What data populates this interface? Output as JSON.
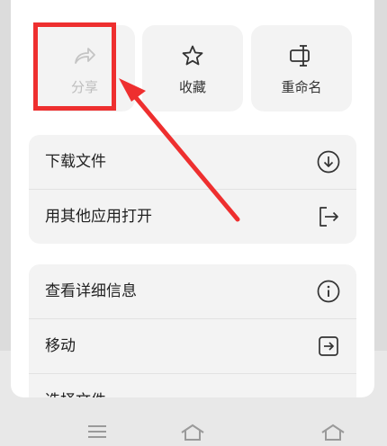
{
  "tiles": [
    {
      "label": "分享",
      "icon": "share-icon",
      "disabled": true
    },
    {
      "label": "收藏",
      "icon": "star-icon"
    },
    {
      "label": "重命名",
      "icon": "rename-icon"
    }
  ],
  "group1": [
    {
      "label": "下载文件",
      "icon": "download-icon"
    },
    {
      "label": "用其他应用打开",
      "icon": "open-with-icon"
    }
  ],
  "group2": [
    {
      "label": "查看详细信息",
      "icon": "info-icon"
    },
    {
      "label": "移动",
      "icon": "move-icon"
    },
    {
      "label": "选择文件",
      "icon": ""
    }
  ],
  "colors": {
    "annotation": "#ee2f2f",
    "sheet": "#ffffff",
    "item_bg": "#f3f3f3"
  }
}
